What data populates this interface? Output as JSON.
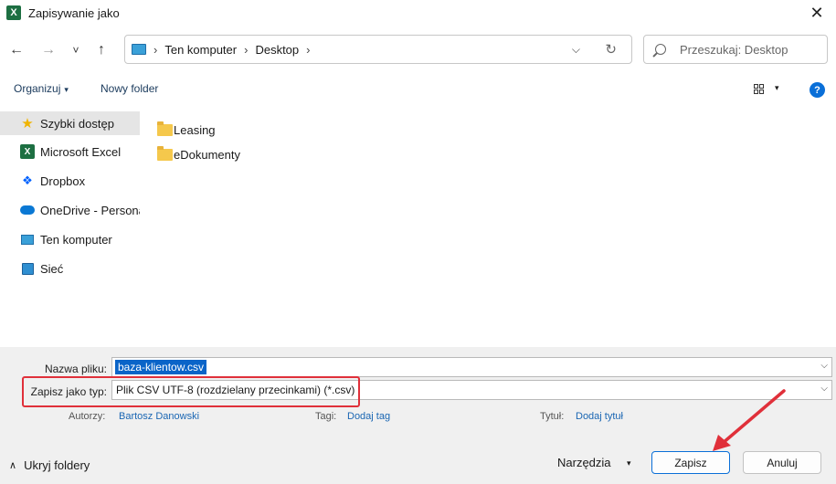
{
  "window": {
    "title": "Zapisywanie jako",
    "app_icon": "X",
    "close": "✕"
  },
  "nav": {
    "back": "←",
    "forward": "→",
    "recent": "˅",
    "up": "↑",
    "breadcrumb": [
      "Ten komputer",
      "Desktop"
    ],
    "separator": "›",
    "dropdown": "⌵",
    "refresh": "↻",
    "search_placeholder": "Przeszukaj: Desktop"
  },
  "toolbar": {
    "organize": "Organizuj",
    "caret": "▾",
    "new_folder": "Nowy folder",
    "view_caret": "▾",
    "help": "?"
  },
  "sidebar": {
    "items": [
      {
        "label": "Szybki dostęp",
        "icon": "star-icon",
        "glyph": "★",
        "selected": true
      },
      {
        "label": "Microsoft Excel",
        "icon": "excel-icon",
        "glyph": "X"
      },
      {
        "label": "Dropbox",
        "icon": "dropbox-icon",
        "glyph": "❖"
      },
      {
        "label": "OneDrive - Personal",
        "icon": "onedrive-icon",
        "glyph": ""
      },
      {
        "label": "Ten komputer",
        "icon": "computer-icon",
        "glyph": ""
      },
      {
        "label": "Sieć",
        "icon": "network-icon",
        "glyph": ""
      }
    ]
  },
  "files": [
    {
      "name": "Leasing",
      "type": "folder"
    },
    {
      "name": "eDokumenty",
      "type": "folder"
    }
  ],
  "save": {
    "filename_label": "Nazwa pliku:",
    "filename_value": "baza-klientow.csv",
    "type_label": "Zapisz jako typ:",
    "type_value": "Plik CSV UTF-8 (rozdzielany przecinkami) (*.csv)",
    "authors_label": "Autorzy:",
    "authors_value": "Bartosz Danowski",
    "tags_label": "Tagi:",
    "tags_value": "Dodaj tag",
    "title_label": "Tytuł:",
    "title_value": "Dodaj tytuł",
    "dropdown": "⌵"
  },
  "footer": {
    "hide_folders": "Ukryj foldery",
    "hide_chevron": "∧",
    "tools": "Narzędzia",
    "tools_caret": "▾",
    "save_button": "Zapisz",
    "cancel_button": "Anuluj"
  },
  "colors": {
    "accent": "#0a6fd8",
    "highlight_box": "#e0303a",
    "selection": "#0a64c8"
  }
}
